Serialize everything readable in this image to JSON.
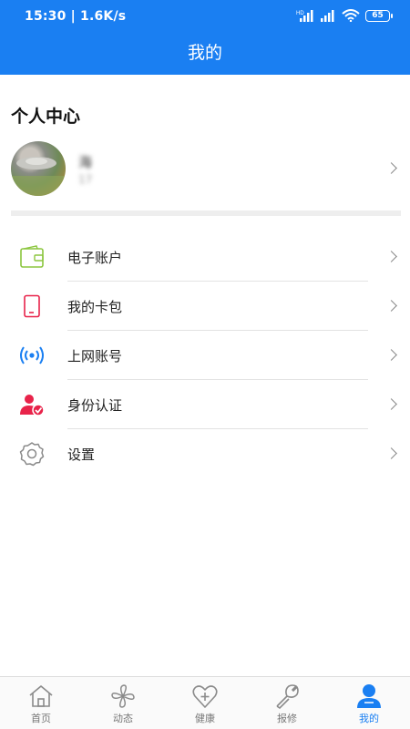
{
  "status": {
    "time_speed": "15:30 | 1.6K/s",
    "battery": "65"
  },
  "header": {
    "title": "我的"
  },
  "section": {
    "title": "个人中心"
  },
  "profile": {
    "name": "海",
    "sub": "17"
  },
  "menu": [
    {
      "label": "电子账户",
      "icon": "wallet-icon",
      "color": "#8cc63f"
    },
    {
      "label": "我的卡包",
      "icon": "card-icon",
      "color": "#e8234a"
    },
    {
      "label": "上网账号",
      "icon": "wifi-broadcast-icon",
      "color": "#1a7ff2"
    },
    {
      "label": "身份认证",
      "icon": "user-verified-icon",
      "color": "#e8234a"
    },
    {
      "label": "设置",
      "icon": "gear-icon",
      "color": "#8a8a8a"
    }
  ],
  "tabs": [
    {
      "label": "首页",
      "icon": "home-icon"
    },
    {
      "label": "动态",
      "icon": "pinwheel-icon"
    },
    {
      "label": "健康",
      "icon": "heart-plus-icon"
    },
    {
      "label": "报修",
      "icon": "wrench-icon"
    },
    {
      "label": "我的",
      "icon": "person-icon",
      "active": true
    }
  ],
  "colors": {
    "primary": "#1a7ff2",
    "band": "#eeeeee"
  }
}
